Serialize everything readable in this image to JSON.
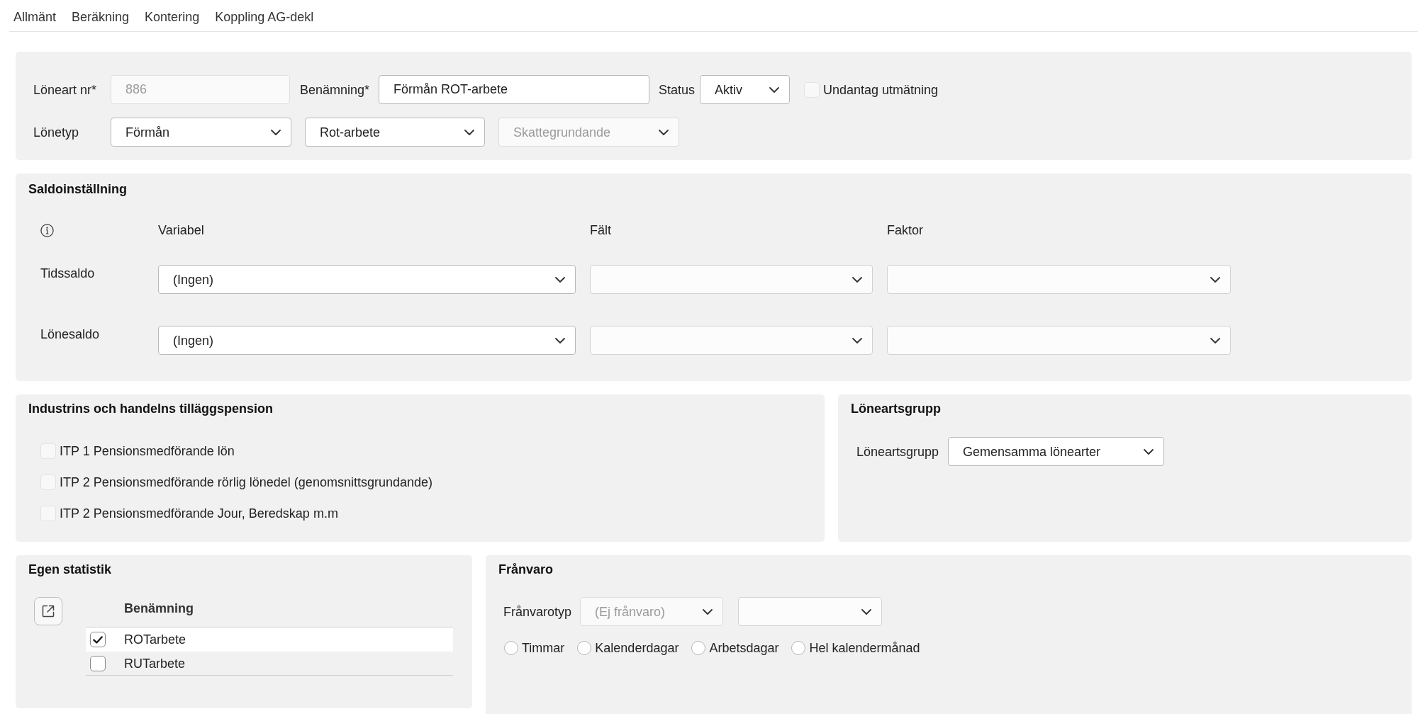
{
  "tabs": [
    "Allmänt",
    "Beräkning",
    "Kontering",
    "Koppling AG-dekl"
  ],
  "general": {
    "number": {
      "label": "Löneart nr*",
      "value": "886",
      "disabled": true
    },
    "name": {
      "label": "Benämning*",
      "value": "Förmån ROT-arbete"
    },
    "status": {
      "label": "Status",
      "value": "Aktiv"
    },
    "garnishment_exemption": {
      "label": "Undantag utmätning",
      "checked": false
    },
    "salary_type": {
      "label": "Lönetyp",
      "selects": [
        {
          "value": "Förmån",
          "disabled": false
        },
        {
          "value": "Rot-arbete",
          "disabled": false
        },
        {
          "value": "Skattegrundande",
          "disabled": true
        }
      ]
    }
  },
  "balance_settings": {
    "title": "Saldoinställning",
    "columns": [
      "Variabel",
      "Fält",
      "Faktor"
    ],
    "rows": [
      {
        "label": "Tidssaldo",
        "variable": "(Ingen)"
      },
      {
        "label": "Lönesaldo",
        "variable": "(Ingen)"
      }
    ]
  },
  "pension": {
    "title": "Industrins och handelns tilläggspension",
    "options": [
      {
        "label": "ITP 1 Pensionsmedförande lön",
        "checked": false
      },
      {
        "label": "ITP 2 Pensionsmedförande rörlig lönedel (genomsnittsgrundande)",
        "checked": false
      },
      {
        "label": "ITP 2 Pensionsmedförande Jour, Beredskap m.m",
        "checked": false
      }
    ]
  },
  "salary_group": {
    "title": "Löneartsgrupp",
    "label": "Löneartsgrupp",
    "value": "Gemensamma lönearter"
  },
  "own_statistics": {
    "title": "Egen statistik",
    "column": "Benämning",
    "rows": [
      {
        "label": "ROTarbete",
        "checked": true
      },
      {
        "label": "RUTarbete",
        "checked": false
      }
    ]
  },
  "absence": {
    "title": "Frånvaro",
    "label": "Frånvarotyp",
    "type": {
      "value": "(Ej frånvaro)",
      "disabled": true
    },
    "units": [
      {
        "label": "Timmar",
        "selected": false
      },
      {
        "label": "Kalenderdagar",
        "selected": false
      },
      {
        "label": "Arbetsdagar",
        "selected": false
      },
      {
        "label": "Hel kalendermånad",
        "selected": false
      }
    ]
  }
}
